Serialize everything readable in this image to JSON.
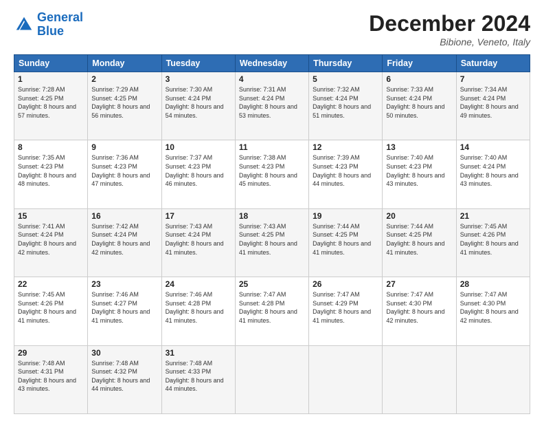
{
  "logo": {
    "line1": "General",
    "line2": "Blue"
  },
  "title": "December 2024",
  "location": "Bibione, Veneto, Italy",
  "days_of_week": [
    "Sunday",
    "Monday",
    "Tuesday",
    "Wednesday",
    "Thursday",
    "Friday",
    "Saturday"
  ],
  "weeks": [
    [
      {
        "day": "1",
        "sunrise": "7:28 AM",
        "sunset": "4:25 PM",
        "daylight": "8 hours and 57 minutes."
      },
      {
        "day": "2",
        "sunrise": "7:29 AM",
        "sunset": "4:25 PM",
        "daylight": "8 hours and 56 minutes."
      },
      {
        "day": "3",
        "sunrise": "7:30 AM",
        "sunset": "4:24 PM",
        "daylight": "8 hours and 54 minutes."
      },
      {
        "day": "4",
        "sunrise": "7:31 AM",
        "sunset": "4:24 PM",
        "daylight": "8 hours and 53 minutes."
      },
      {
        "day": "5",
        "sunrise": "7:32 AM",
        "sunset": "4:24 PM",
        "daylight": "8 hours and 51 minutes."
      },
      {
        "day": "6",
        "sunrise": "7:33 AM",
        "sunset": "4:24 PM",
        "daylight": "8 hours and 50 minutes."
      },
      {
        "day": "7",
        "sunrise": "7:34 AM",
        "sunset": "4:24 PM",
        "daylight": "8 hours and 49 minutes."
      }
    ],
    [
      {
        "day": "8",
        "sunrise": "7:35 AM",
        "sunset": "4:23 PM",
        "daylight": "8 hours and 48 minutes."
      },
      {
        "day": "9",
        "sunrise": "7:36 AM",
        "sunset": "4:23 PM",
        "daylight": "8 hours and 47 minutes."
      },
      {
        "day": "10",
        "sunrise": "7:37 AM",
        "sunset": "4:23 PM",
        "daylight": "8 hours and 46 minutes."
      },
      {
        "day": "11",
        "sunrise": "7:38 AM",
        "sunset": "4:23 PM",
        "daylight": "8 hours and 45 minutes."
      },
      {
        "day": "12",
        "sunrise": "7:39 AM",
        "sunset": "4:23 PM",
        "daylight": "8 hours and 44 minutes."
      },
      {
        "day": "13",
        "sunrise": "7:40 AM",
        "sunset": "4:23 PM",
        "daylight": "8 hours and 43 minutes."
      },
      {
        "day": "14",
        "sunrise": "7:40 AM",
        "sunset": "4:24 PM",
        "daylight": "8 hours and 43 minutes."
      }
    ],
    [
      {
        "day": "15",
        "sunrise": "7:41 AM",
        "sunset": "4:24 PM",
        "daylight": "8 hours and 42 minutes."
      },
      {
        "day": "16",
        "sunrise": "7:42 AM",
        "sunset": "4:24 PM",
        "daylight": "8 hours and 42 minutes."
      },
      {
        "day": "17",
        "sunrise": "7:43 AM",
        "sunset": "4:24 PM",
        "daylight": "8 hours and 41 minutes."
      },
      {
        "day": "18",
        "sunrise": "7:43 AM",
        "sunset": "4:25 PM",
        "daylight": "8 hours and 41 minutes."
      },
      {
        "day": "19",
        "sunrise": "7:44 AM",
        "sunset": "4:25 PM",
        "daylight": "8 hours and 41 minutes."
      },
      {
        "day": "20",
        "sunrise": "7:44 AM",
        "sunset": "4:25 PM",
        "daylight": "8 hours and 41 minutes."
      },
      {
        "day": "21",
        "sunrise": "7:45 AM",
        "sunset": "4:26 PM",
        "daylight": "8 hours and 41 minutes."
      }
    ],
    [
      {
        "day": "22",
        "sunrise": "7:45 AM",
        "sunset": "4:26 PM",
        "daylight": "8 hours and 41 minutes."
      },
      {
        "day": "23",
        "sunrise": "7:46 AM",
        "sunset": "4:27 PM",
        "daylight": "8 hours and 41 minutes."
      },
      {
        "day": "24",
        "sunrise": "7:46 AM",
        "sunset": "4:28 PM",
        "daylight": "8 hours and 41 minutes."
      },
      {
        "day": "25",
        "sunrise": "7:47 AM",
        "sunset": "4:28 PM",
        "daylight": "8 hours and 41 minutes."
      },
      {
        "day": "26",
        "sunrise": "7:47 AM",
        "sunset": "4:29 PM",
        "daylight": "8 hours and 41 minutes."
      },
      {
        "day": "27",
        "sunrise": "7:47 AM",
        "sunset": "4:30 PM",
        "daylight": "8 hours and 42 minutes."
      },
      {
        "day": "28",
        "sunrise": "7:47 AM",
        "sunset": "4:30 PM",
        "daylight": "8 hours and 42 minutes."
      }
    ],
    [
      {
        "day": "29",
        "sunrise": "7:48 AM",
        "sunset": "4:31 PM",
        "daylight": "8 hours and 43 minutes."
      },
      {
        "day": "30",
        "sunrise": "7:48 AM",
        "sunset": "4:32 PM",
        "daylight": "8 hours and 44 minutes."
      },
      {
        "day": "31",
        "sunrise": "7:48 AM",
        "sunset": "4:33 PM",
        "daylight": "8 hours and 44 minutes."
      },
      null,
      null,
      null,
      null
    ]
  ]
}
